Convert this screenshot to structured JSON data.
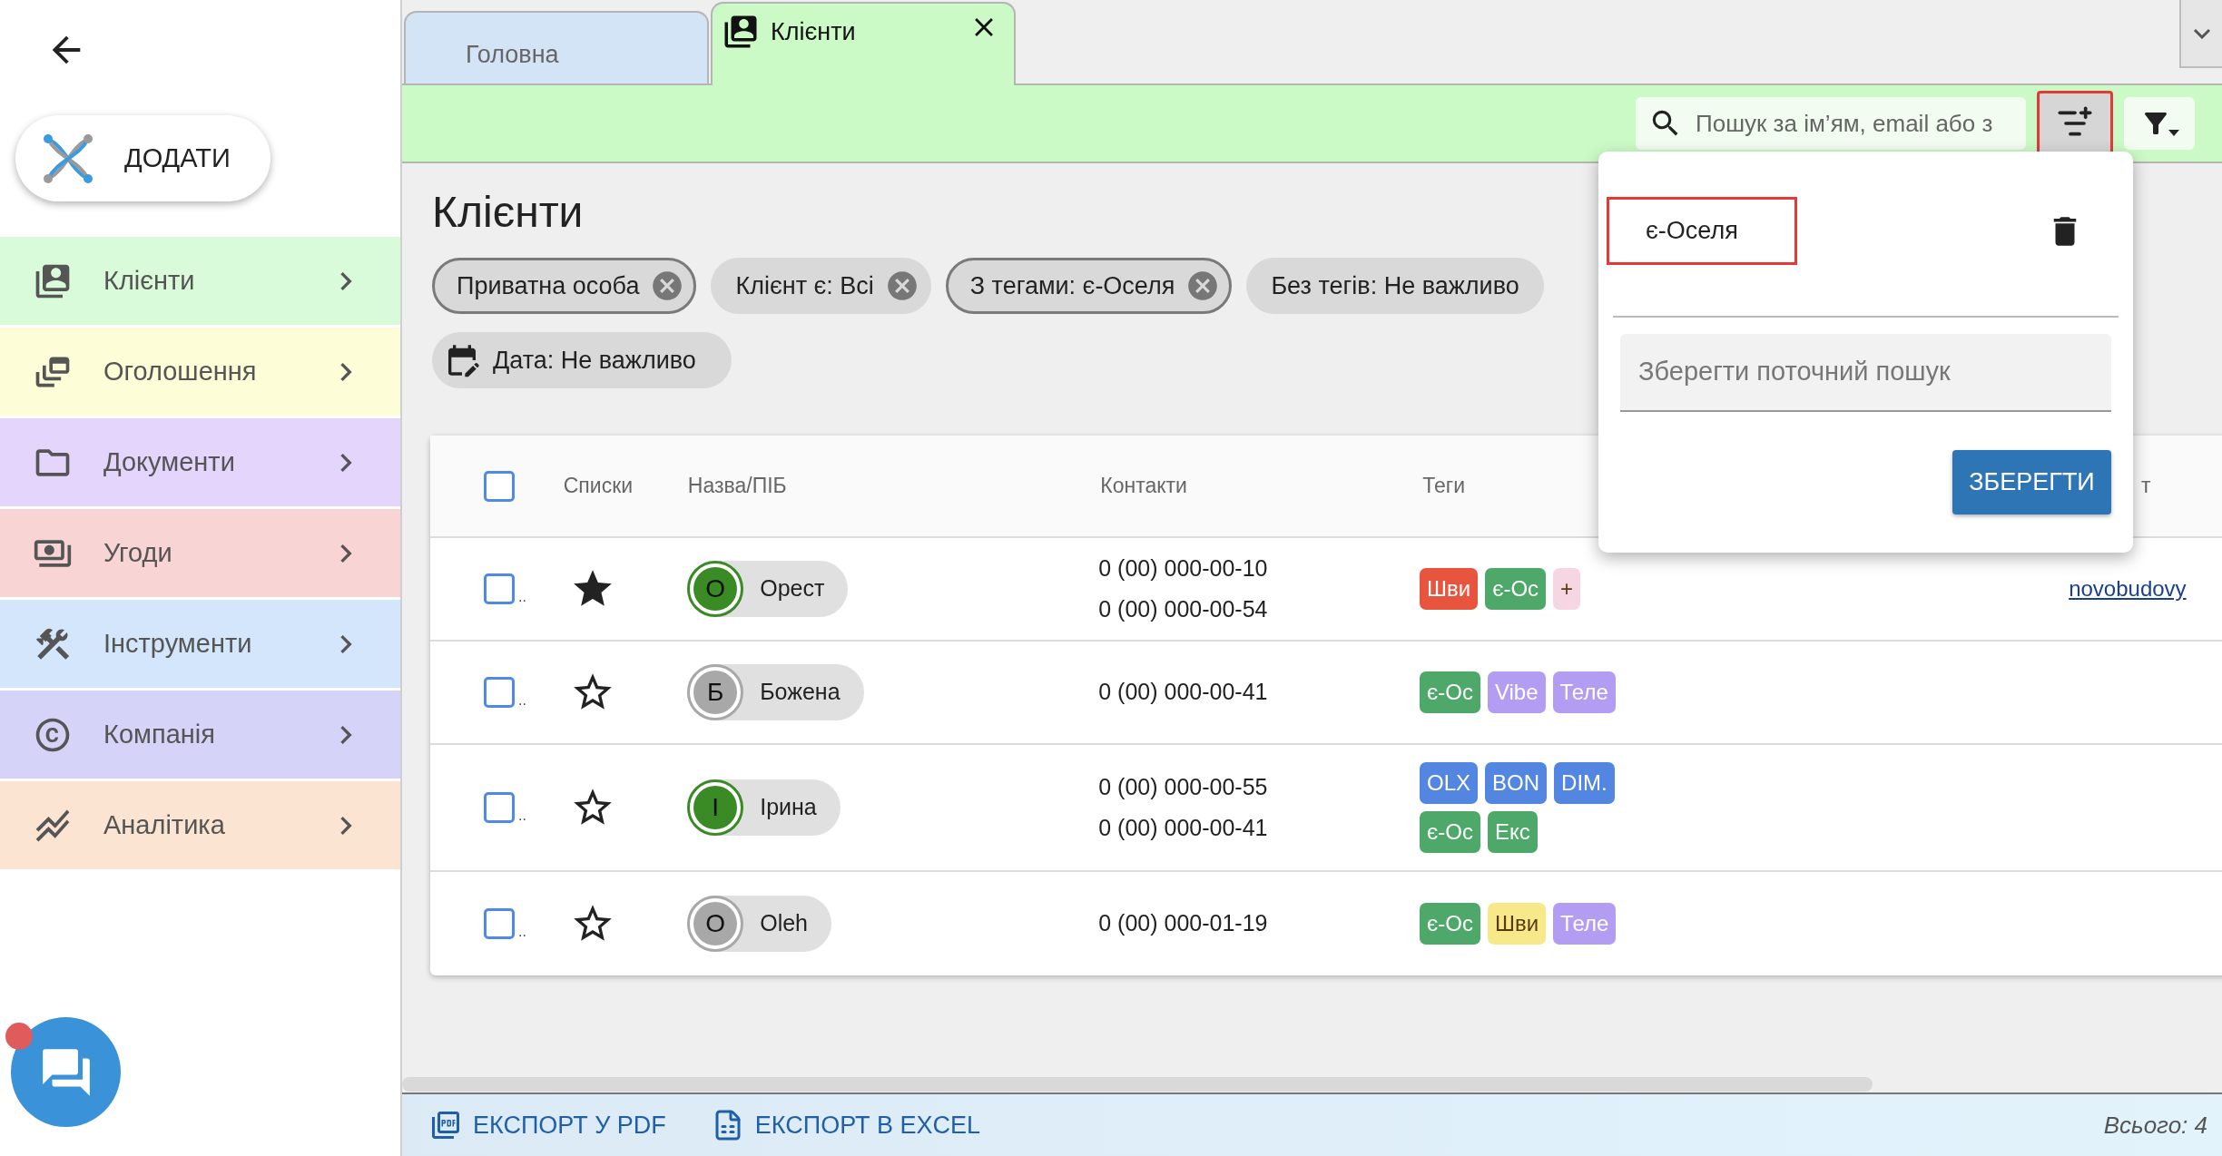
{
  "sidebar": {
    "add_button": "ДОДАТИ",
    "items": [
      {
        "kind": "clients",
        "label": "Клієнти",
        "color": "#d9fbd9"
      },
      {
        "kind": "ads",
        "label": "Оголошення",
        "color": "#fdfdd8"
      },
      {
        "kind": "documents",
        "label": "Документи",
        "color": "#e3d5fb"
      },
      {
        "kind": "deals",
        "label": "Угоди",
        "color": "#f8d4d4"
      },
      {
        "kind": "tools",
        "label": "Інструменти",
        "color": "#d3e6fb"
      },
      {
        "kind": "company",
        "label": "Компанія",
        "color": "#d5d3f8"
      },
      {
        "kind": "analytics",
        "label": "Аналітика",
        "color": "#fbe4d1"
      }
    ],
    "chat": {
      "notification": true
    }
  },
  "tabs": [
    {
      "label": "Головна",
      "selected": false
    },
    {
      "label": "Клієнти",
      "selected": true
    }
  ],
  "toolbar": {
    "search": {
      "placeholder": "Пошук за ім’ям, email або з"
    },
    "saved_searches_button": {
      "highlighted": true
    }
  },
  "popup": {
    "saved_searches": [
      {
        "label": "є-Оселя",
        "highlighted": true
      }
    ],
    "name_field": {
      "placeholder": "Зберегти поточний пошук"
    },
    "save_button": "ЗБЕРЕГТИ"
  },
  "page": {
    "title": "Клієнти",
    "chips": [
      {
        "kind": "filter",
        "label": "Приватна особа",
        "outlined": true,
        "removable": true
      },
      {
        "kind": "filter",
        "label": "Клієнт є: Всі",
        "outlined": false,
        "removable": true
      },
      {
        "kind": "filter",
        "label": "З тегами: є-Оселя",
        "outlined": true,
        "removable": true
      },
      {
        "kind": "filter",
        "label": "Без тегів: Не важливо",
        "outlined": false,
        "removable": false
      },
      {
        "kind": "date",
        "label": "Дата: Не важливо",
        "outlined": false,
        "removable": false
      }
    ]
  },
  "table": {
    "all_checked": false,
    "columns": [
      "Списки",
      "Назва/ПІБ",
      "Контакти",
      "Теги",
      "т"
    ],
    "rows": [
      {
        "checked": false,
        "marker": "..",
        "starred": true,
        "avatar": {
          "initial": "О",
          "color": "#3a8a25"
        },
        "name": "Орест",
        "contacts": [
          "0 (00) 000-00-10",
          "0 (00) 000-00-54"
        ],
        "tags": [
          {
            "label": "Шви",
            "color": "#e8553e"
          },
          {
            "label": "є-Ос",
            "color": "#4ea86a"
          },
          {
            "label": "+",
            "color": "#f5d6e2"
          }
        ],
        "link": "novobudovy"
      },
      {
        "checked": false,
        "marker": "..",
        "starred": false,
        "avatar": {
          "initial": "Б",
          "color": "#a8a8a8"
        },
        "name": "Божена",
        "contacts": [
          "0 (00) 000-00-41"
        ],
        "tags": [
          {
            "label": "є-Ос",
            "color": "#4ea86a"
          },
          {
            "label": "Vibe",
            "color": "#b39df3"
          },
          {
            "label": "Теле",
            "color": "#b39df3"
          }
        ]
      },
      {
        "checked": false,
        "marker": "..",
        "starred": false,
        "avatar": {
          "initial": "І",
          "color": "#3a8a25"
        },
        "name": "Ірина",
        "contacts": [
          "0 (00) 000-00-55",
          "0 (00) 000-00-41"
        ],
        "tags": [
          {
            "label": "OLX",
            "color": "#5286e0"
          },
          {
            "label": "BON",
            "color": "#5286e0"
          },
          {
            "label": "DIM.",
            "color": "#5286e0"
          },
          {
            "label": "є-Ос",
            "color": "#4ea86a"
          },
          {
            "label": "Екс",
            "color": "#4ea86a"
          }
        ]
      },
      {
        "checked": false,
        "marker": "..",
        "starred": false,
        "avatar": {
          "initial": "O",
          "color": "#a8a8a8"
        },
        "name": "Oleh",
        "contacts": [
          "0 (00) 000-01-19"
        ],
        "tags": [
          {
            "label": "є-Ос",
            "color": "#4ea86a"
          },
          {
            "label": "Шви",
            "color": "#f7e88a"
          },
          {
            "label": "Теле",
            "color": "#b39df3"
          }
        ]
      }
    ]
  },
  "footer": {
    "exports": [
      {
        "kind": "pdf",
        "label": "ЕКСПОРТ У PDF"
      },
      {
        "kind": "excel",
        "label": "ЕКСПОРТ В EXCEL"
      }
    ],
    "total": "Всього: 4"
  }
}
